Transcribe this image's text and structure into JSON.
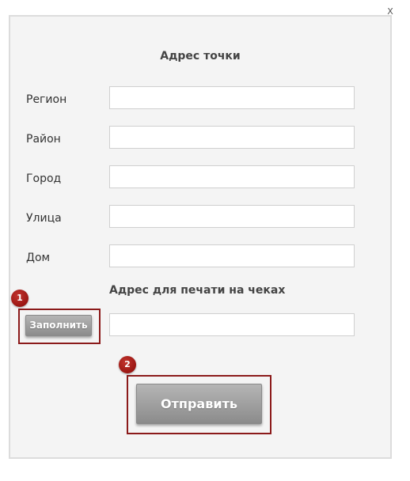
{
  "close_label": "X",
  "address_section": {
    "title": "Адрес точки",
    "fields": [
      {
        "label": "Регион",
        "value": ""
      },
      {
        "label": "Район",
        "value": ""
      },
      {
        "label": "Город",
        "value": ""
      },
      {
        "label": "Улица",
        "value": ""
      },
      {
        "label": "Дом",
        "value": ""
      }
    ]
  },
  "print_section": {
    "title": "Адрес для печати на чеках",
    "fill_button": "Заполнить",
    "value": ""
  },
  "submit_button": "Отправить",
  "annotations": {
    "badge_1": "1",
    "badge_2": "2",
    "color": "#8b1a1a"
  }
}
